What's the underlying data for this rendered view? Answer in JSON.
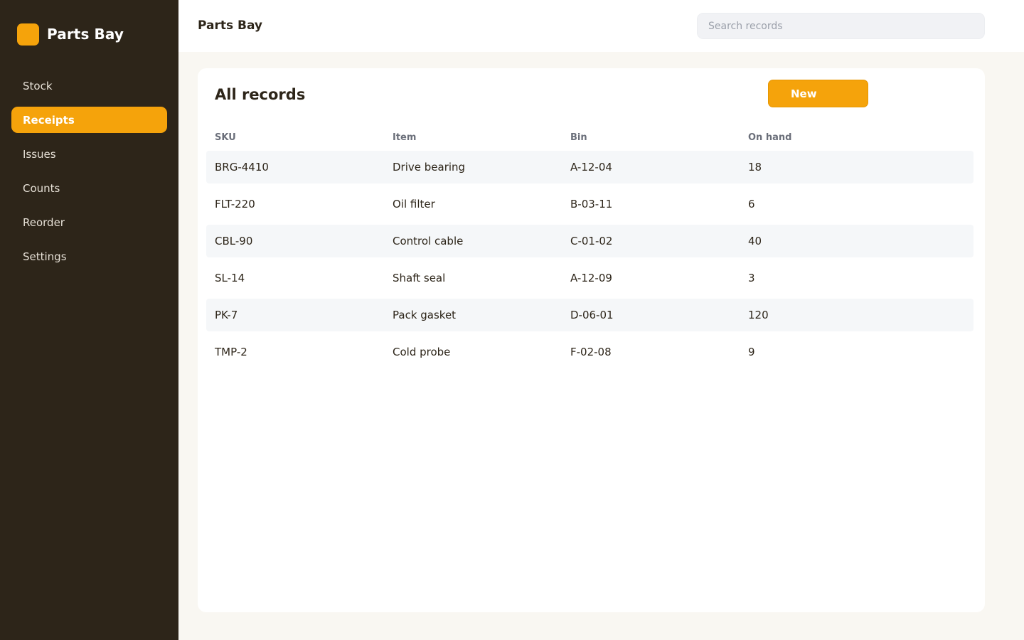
{
  "app": {
    "name": "Parts Bay"
  },
  "sidebar": {
    "items": [
      {
        "label": "Stock",
        "active": false
      },
      {
        "label": "Receipts",
        "active": true
      },
      {
        "label": "Issues",
        "active": false
      },
      {
        "label": "Counts",
        "active": false
      },
      {
        "label": "Reorder",
        "active": false
      },
      {
        "label": "Settings",
        "active": false
      }
    ]
  },
  "topbar": {
    "title": "Parts Bay",
    "search_placeholder": "Search records"
  },
  "main": {
    "title": "All records",
    "new_label": "New",
    "table": {
      "headers": [
        "SKU",
        "Item",
        "Bin",
        "On hand"
      ],
      "rows": [
        [
          "BRG-4410",
          "Drive bearing",
          "A-12-04",
          "18"
        ],
        [
          "FLT-220",
          "Oil filter",
          "B-03-11",
          "6"
        ],
        [
          "CBL-90",
          "Control cable",
          "C-01-02",
          "40"
        ],
        [
          "SL-14",
          "Shaft seal",
          "A-12-09",
          "3"
        ],
        [
          "PK-7",
          "Pack gasket",
          "D-06-01",
          "120"
        ],
        [
          "TMP-2",
          "Cold probe",
          "F-02-08",
          "9"
        ]
      ]
    }
  },
  "colors": {
    "sidebar_bg": "#2d2519",
    "accent": "#f5a30b",
    "page_bg": "#f9f7f2",
    "row_stripe": "#f5f7f9"
  }
}
